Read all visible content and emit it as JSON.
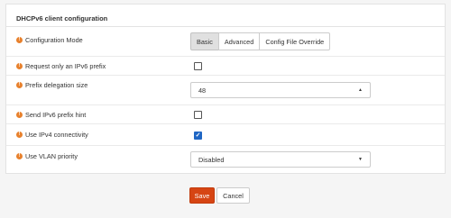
{
  "panel": {
    "title": "DHCPv6 client configuration"
  },
  "fields": {
    "config_mode": {
      "label": "Configuration Mode",
      "options": [
        "Basic",
        "Advanced",
        "Config File Override"
      ],
      "selected": "Basic"
    },
    "request_prefix": {
      "label": "Request only an IPv6 prefix",
      "checked": false
    },
    "prefix_delegation": {
      "label": "Prefix delegation size",
      "value": "48"
    },
    "send_prefix_hint": {
      "label": "Send IPv6 prefix hint",
      "checked": false
    },
    "use_ipv4": {
      "label": "Use IPv4 connectivity",
      "checked": true,
      "check_mark": "✓"
    },
    "vlan_priority": {
      "label": "Use VLAN priority",
      "value": "Disabled"
    }
  },
  "icons": {
    "info": "info-icon",
    "info_glyph": "!"
  },
  "buttons": {
    "save": "Save",
    "cancel": "Cancel"
  },
  "colors": {
    "save": "#d64513",
    "info": "#e8812d",
    "checkbox_checked": "#1f66c4"
  }
}
